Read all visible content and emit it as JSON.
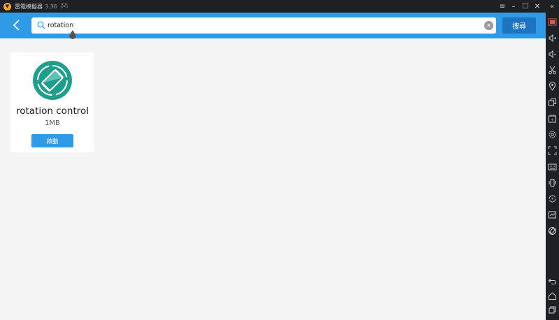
{
  "window": {
    "title": "雷電模擬器",
    "version": "3.36",
    "gamepad_icon": "gamepad-icon",
    "controls": [
      "menu-icon",
      "minimize-icon",
      "maximize-icon",
      "close-icon",
      "collapse-sidebar-icon"
    ]
  },
  "search": {
    "query": "rotation",
    "button_label": "搜尋",
    "icons": {
      "back": "back-arrow-icon",
      "search": "search-icon",
      "clear": "clear-icon"
    }
  },
  "results": [
    {
      "name": "rotation control",
      "size": "1MB",
      "action_label": "啟動",
      "icon": "rotation-control-app-icon"
    }
  ],
  "sidebar": {
    "items": [
      "keyboard-mapping-icon",
      "volume-up-icon",
      "volume-down-icon",
      "screenshot-scissors-icon",
      "location-icon",
      "multi-instance-icon",
      "install-apk-icon",
      "settings-gear-icon",
      "fullscreen-icon",
      "keyboard-icon",
      "shake-icon",
      "sync-icon",
      "record-icon",
      "rotate-icon"
    ],
    "bottom_items": [
      "nav-back-icon",
      "nav-home-icon",
      "nav-recent-icon"
    ]
  },
  "colors": {
    "accent": "#2f9ae6",
    "button_dark": "#1d75c2",
    "app_icon": "#1e9f8e",
    "titlebar": "#1f2023"
  }
}
